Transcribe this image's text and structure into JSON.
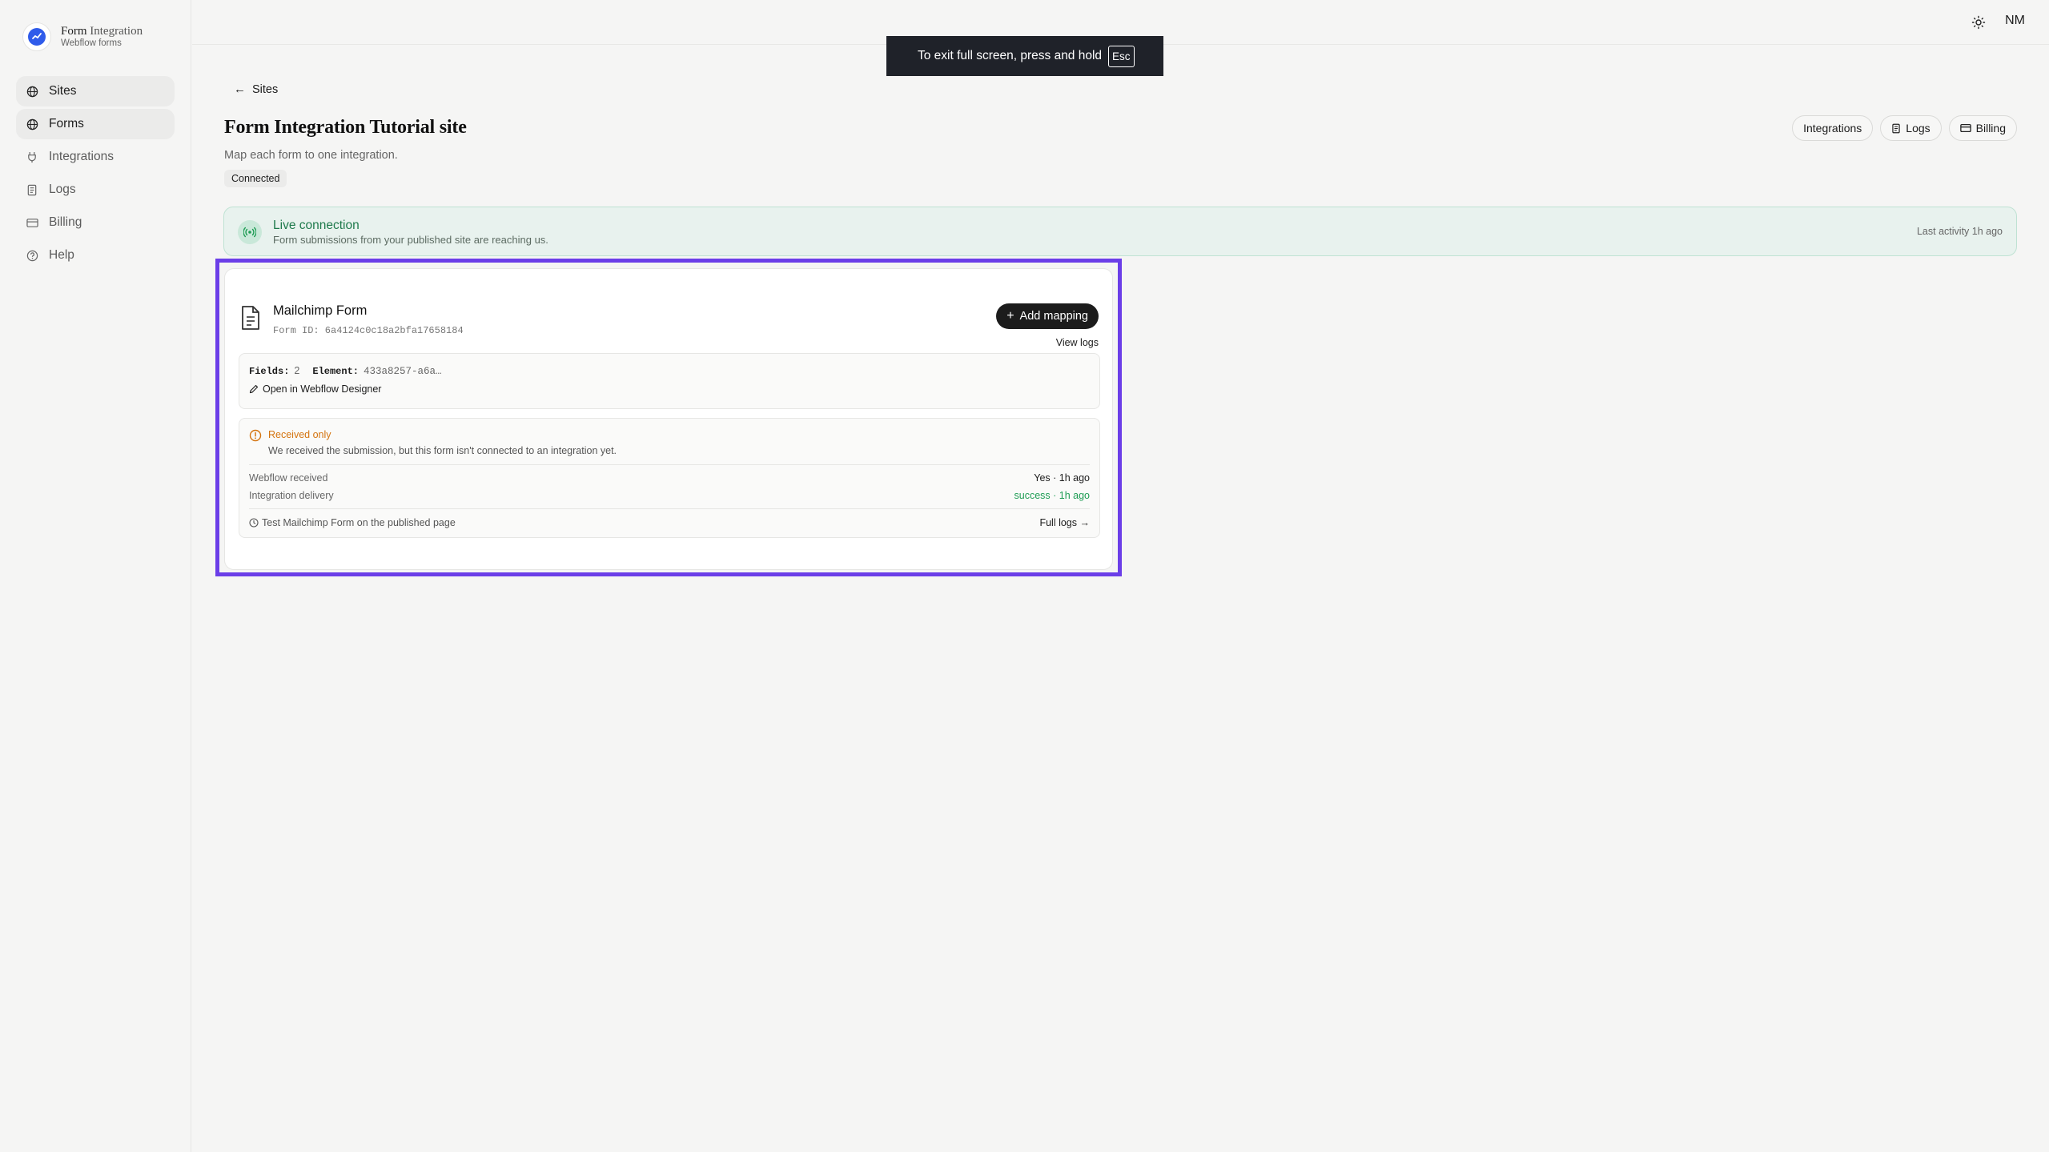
{
  "brand": {
    "title_primary": "Form",
    "title_secondary": "Integration",
    "subtitle": "Webflow forms"
  },
  "sidebar": {
    "items": [
      {
        "label": "Sites",
        "icon": "globe-icon",
        "active": true
      },
      {
        "label": "Forms",
        "icon": "globe-icon",
        "active": true
      },
      {
        "label": "Integrations",
        "icon": "plug-icon",
        "active": false
      },
      {
        "label": "Logs",
        "icon": "scroll-icon",
        "active": false
      },
      {
        "label": "Billing",
        "icon": "credit-card-icon",
        "active": false
      },
      {
        "label": "Help",
        "icon": "help-circle-icon",
        "active": false
      }
    ]
  },
  "topbar": {
    "user_initials": "NM",
    "theme_icon": "sun-icon"
  },
  "fullscreen_toast": {
    "text": "To exit full screen, press and hold",
    "key": "Esc"
  },
  "page": {
    "back_label": "Sites",
    "title": "Form Integration Tutorial site",
    "subtitle": "Map each form to one integration.",
    "status": "Connected",
    "header_buttons": {
      "integrations": "Integrations",
      "logs": "Logs",
      "billing": "Billing"
    }
  },
  "live_banner": {
    "title": "Live connection",
    "description": "Form submissions from your published site are reaching us.",
    "activity": "Last activity 1h ago",
    "accent": "#1f7a4c"
  },
  "form_card": {
    "name": "Mailchimp Form",
    "form_id": "Form ID: 6a4124c0c18a2bfa17658184",
    "add_mapping_label": "Add mapping",
    "view_logs_label": "View logs",
    "fields_label": "Fields:",
    "fields_value": "2",
    "element_label": "Element:",
    "element_value": "433a8257-a6a…",
    "designer_link": "Open in Webflow Designer",
    "status_title": "Received only",
    "status_description": "We received the submission, but this form isn't connected to an integration yet.",
    "rows": [
      {
        "label": "Webflow received",
        "value": "Yes · 1h ago"
      },
      {
        "label": "Integration delivery",
        "value": "success · 1h ago"
      }
    ],
    "test_label": "Test Mailchimp Form on the published page",
    "full_logs_label": "Full logs →",
    "highlight_color": "#6b3ee8",
    "warning_color": "#d4740f",
    "success_color": "#1f9d55"
  }
}
